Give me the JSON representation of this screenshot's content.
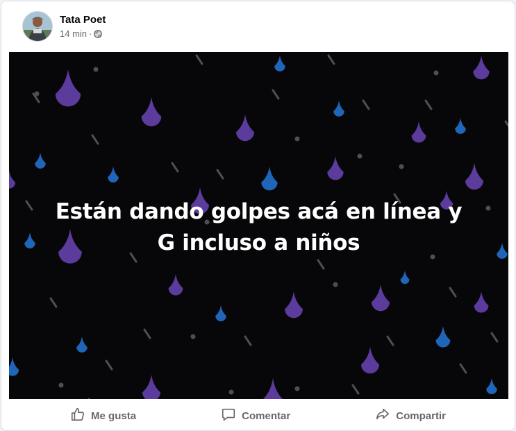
{
  "post": {
    "author": "Tata Poet",
    "time": "14 min",
    "separator": "·",
    "privacy_icon": "globe-icon",
    "text": "Están dando golpes acá en línea y G incluso a niños",
    "background": {
      "color": "#070709",
      "drop_colors": [
        "#5b3b9c",
        "#1f65b8",
        "#4d4f57"
      ]
    }
  },
  "actions": {
    "like_label": "Me gusta",
    "comment_label": "Comentar",
    "share_label": "Compartir"
  }
}
